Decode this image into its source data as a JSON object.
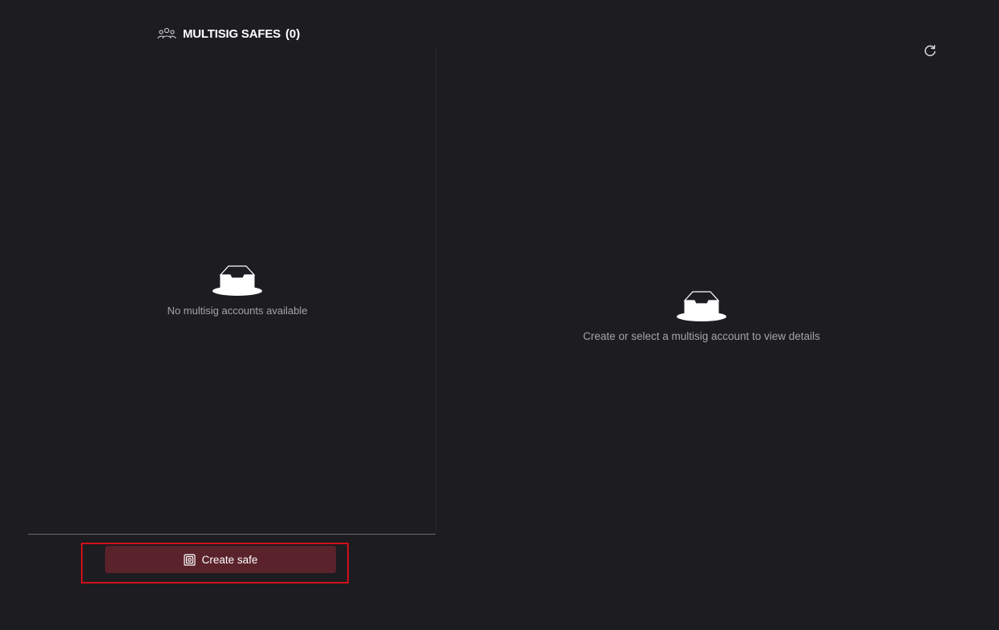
{
  "multisig_list": {
    "title": "MULTISIG SAFES",
    "count": "(0)",
    "empty_message": "No multisig accounts available",
    "create_button_label": "Create safe"
  },
  "details": {
    "empty_message": "Create or select a multisig account to view details"
  },
  "icons": {
    "header": "users-icon",
    "empty": "inbox-icon",
    "create": "safe-icon",
    "refresh": "refresh-icon"
  },
  "colors": {
    "background": "#1c1c21",
    "button_bg": "#5a222b",
    "highlight_border": "#d0101b",
    "muted_text": "#a4a4a9"
  }
}
